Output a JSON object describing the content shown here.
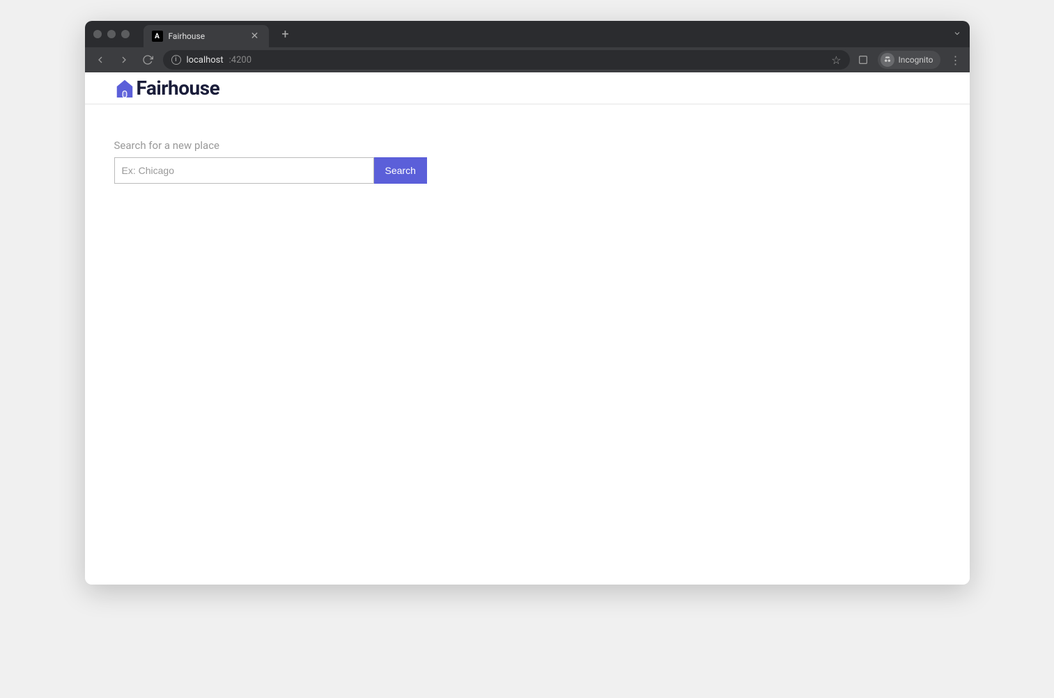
{
  "browser": {
    "tab": {
      "favicon_letter": "A",
      "title": "Fairhouse"
    },
    "url_host": "localhost",
    "url_port": ":4200",
    "incognito_label": "Incognito"
  },
  "app": {
    "brand_name": "Fairhouse",
    "colors": {
      "brand": "#5b5fd9",
      "text_dark": "#1a1d3a"
    }
  },
  "search": {
    "label": "Search for a new place",
    "placeholder": "Ex: Chicago",
    "value": "",
    "button_label": "Search"
  }
}
